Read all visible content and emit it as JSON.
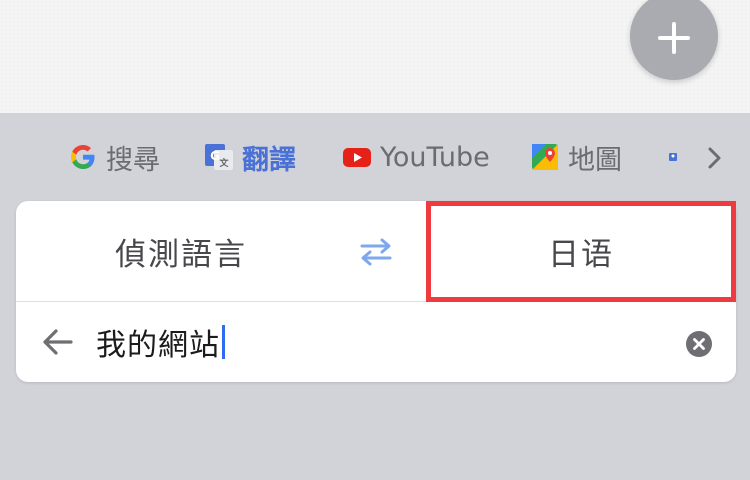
{
  "shortcuts": [
    {
      "label": "搜尋",
      "icon": "google-g-icon"
    },
    {
      "label": "翻譯",
      "icon": "google-translate-icon",
      "active": true
    },
    {
      "label": "YouTube",
      "icon": "youtube-icon"
    },
    {
      "label": "地圖",
      "icon": "google-maps-icon"
    }
  ],
  "translator": {
    "source_language": "偵測語言",
    "target_language": "日语",
    "input_text": "我的網站"
  },
  "colors": {
    "active_tab": "#4a72d6",
    "highlight": "#ef3b3f",
    "caret": "#2f6cf2",
    "swap_icon": "#7ea8ee"
  }
}
